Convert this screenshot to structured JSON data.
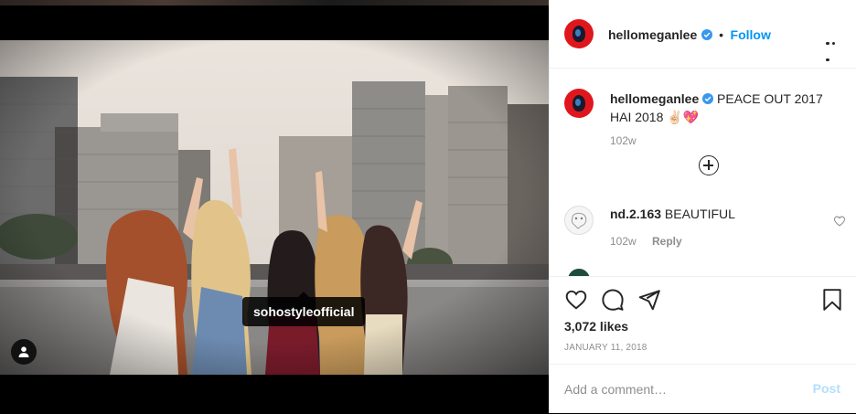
{
  "photo": {
    "tag_username": "sohostyleofficial",
    "user_tag_icon": "user-icon"
  },
  "post": {
    "header": {
      "username": "hellomeganlee",
      "separator": "•",
      "follow_label": "Follow",
      "more_icon": "more-options-icon"
    },
    "caption": {
      "username": "hellomeganlee",
      "text": " PEACE OUT 2017 HAI 2018 ✌🏻💖",
      "time": "102w",
      "load_more_icon": "plus-circle-icon"
    },
    "comments": [
      {
        "username": "nd.2.163",
        "text": " BEAUTIFUL",
        "time": "102w",
        "reply_label": "Reply",
        "like_icon": "heart-outline-icon"
      }
    ],
    "actions": {
      "like_icon": "heart-icon",
      "comment_icon": "comment-icon",
      "share_icon": "send-icon",
      "save_icon": "bookmark-icon"
    },
    "likes": "3,072 likes",
    "date": "JANUARY 11, 2018",
    "add_comment": {
      "placeholder": "Add a comment…",
      "post_label": "Post"
    }
  },
  "colors": {
    "accent": "#0095f6",
    "post_disabled": "#b2dffc",
    "avatar_red": "#e0161d"
  }
}
